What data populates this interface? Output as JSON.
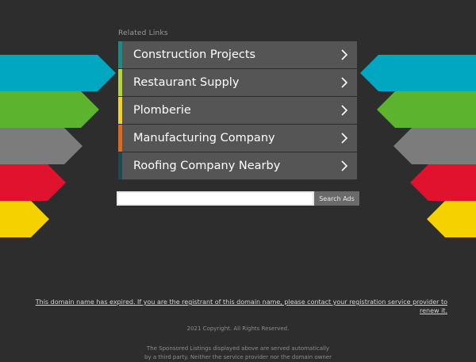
{
  "colors": {
    "background": "#2d2d2d",
    "arrows": [
      "#00a7c0",
      "#5cb32e",
      "#7c7c7c",
      "#e0122e",
      "#f5d100"
    ],
    "link_accents": [
      "#1e8a88",
      "#b7d63b",
      "#f2d12c",
      "#e06a1b",
      "#1f4a55"
    ],
    "link_bg": "#555555"
  },
  "related": {
    "title": "Related Links",
    "links": [
      {
        "label": "Construction Projects",
        "icon": "chevron-right-icon"
      },
      {
        "label": "Restaurant Supply",
        "icon": "chevron-right-icon"
      },
      {
        "label": "Plomberie",
        "icon": "chevron-right-icon"
      },
      {
        "label": "Manufacturing Company",
        "icon": "chevron-right-icon"
      },
      {
        "label": "Roofing Company Nearby",
        "icon": "chevron-right-icon"
      }
    ]
  },
  "search": {
    "placeholder": "",
    "button_label": "Search Ads"
  },
  "footer": {
    "expired_text": "This domain name has expired. If you are the registrant of this domain name, please contact your registration service provider to renew it.",
    "copyright": "2021 Copyright. All Rights Reserved.",
    "disclaimer_line1": "The Sponsored Listings displayed above are served automatically",
    "disclaimer_line2": "by a third party. Neither the service provider nor the domain owner"
  }
}
